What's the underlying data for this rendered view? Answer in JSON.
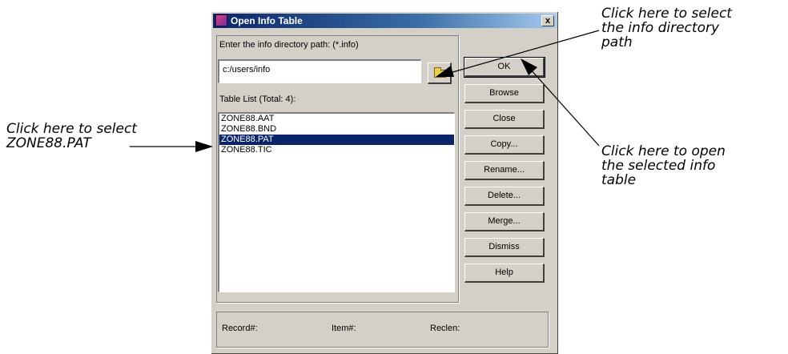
{
  "dialog": {
    "title": "Open Info Table",
    "close_label": "x",
    "path_label": "Enter the info directory path: (*.info)",
    "path_value": "c:/users/info",
    "table_list_label": "Table List (Total: 4):",
    "tables": [
      "ZONE88.AAT",
      "ZONE88.BND",
      "ZONE88.PAT",
      "ZONE88.TIC"
    ],
    "selected_table": "ZONE88.PAT",
    "buttons": {
      "ok": "OK",
      "browse": "Browse",
      "close": "Close",
      "copy": "Copy...",
      "rename": "Rename...",
      "delete": "Delete...",
      "merge": "Merge...",
      "dismiss": "Dismiss",
      "help": "Help"
    },
    "status": {
      "record": "Record#:",
      "item": "Item#:",
      "reclen": "Reclen:"
    }
  },
  "callouts": {
    "select_table": [
      "Click here to select",
      "ZONE88.PAT"
    ],
    "select_path": [
      "Click here to select",
      "the info directory",
      "path"
    ],
    "open_table": [
      "Click here to open",
      "the selected info",
      "table"
    ]
  },
  "colors": {
    "selection": "#0a246a",
    "dialog_face": "#d4d0c8"
  }
}
